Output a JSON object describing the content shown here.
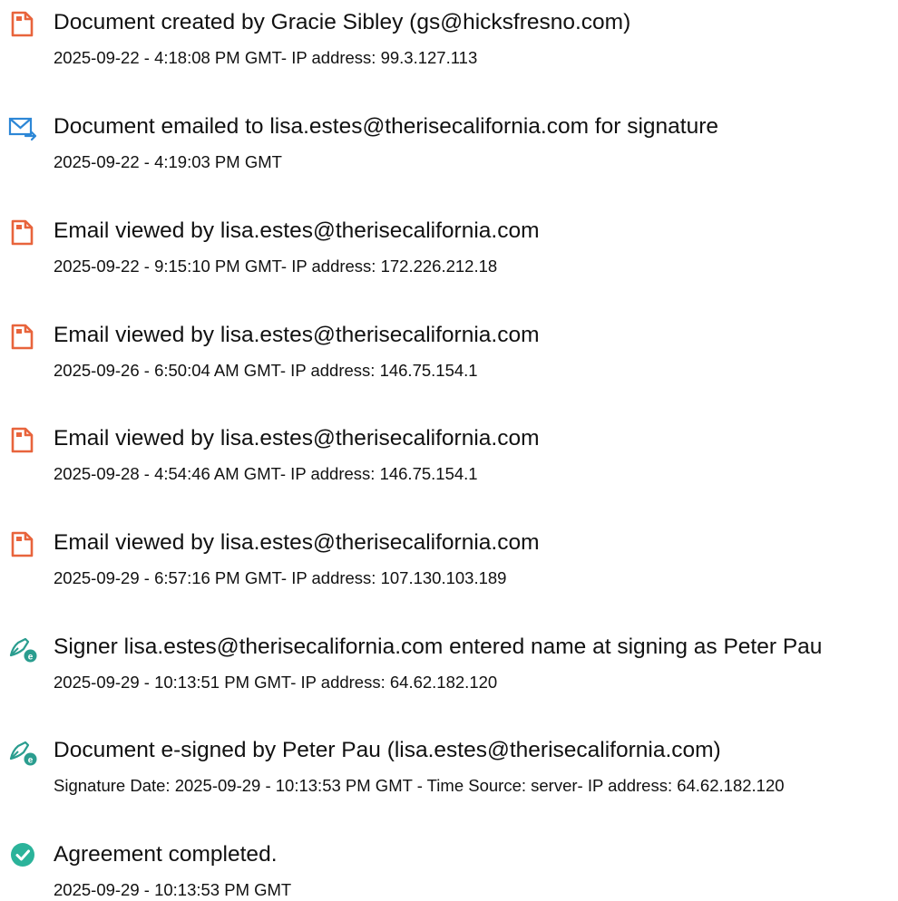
{
  "events": [
    {
      "icon": "document-icon",
      "title": "Document created by Gracie Sibley (gs@hicksfresno.com)",
      "detail": "2025-09-22 - 4:18:08 PM GMT- IP address: 99.3.127.113"
    },
    {
      "icon": "email-send-icon",
      "title": "Document emailed to lisa.estes@therisecalifornia.com for signature",
      "detail": "2025-09-22 - 4:19:03 PM GMT"
    },
    {
      "icon": "document-icon",
      "title": "Email viewed by lisa.estes@therisecalifornia.com",
      "detail": "2025-09-22 - 9:15:10 PM GMT- IP address: 172.226.212.18"
    },
    {
      "icon": "document-icon",
      "title": "Email viewed by lisa.estes@therisecalifornia.com",
      "detail": "2025-09-26 - 6:50:04 AM GMT- IP address: 146.75.154.1"
    },
    {
      "icon": "document-icon",
      "title": "Email viewed by lisa.estes@therisecalifornia.com",
      "detail": "2025-09-28 - 4:54:46 AM GMT- IP address: 146.75.154.1"
    },
    {
      "icon": "document-icon",
      "title": "Email viewed by lisa.estes@therisecalifornia.com",
      "detail": "2025-09-29 - 6:57:16 PM GMT- IP address: 107.130.103.189"
    },
    {
      "icon": "pen-sign-icon",
      "title": "Signer lisa.estes@therisecalifornia.com entered name at signing as Peter Pau",
      "detail": "2025-09-29 - 10:13:51 PM GMT- IP address: 64.62.182.120"
    },
    {
      "icon": "pen-sign-icon",
      "title": "Document e-signed by Peter Pau (lisa.estes@therisecalifornia.com)",
      "detail": "Signature Date: 2025-09-29 - 10:13:53 PM GMT - Time Source: server- IP address: 64.62.182.120"
    },
    {
      "icon": "check-circle-icon",
      "title": "Agreement completed.",
      "detail": "2025-09-29 - 10:13:53 PM GMT"
    }
  ],
  "colors": {
    "document_icon": "#E8643C",
    "email_icon": "#2D87D6",
    "pen_icon": "#2A9D8F",
    "check_icon": "#2BB39A",
    "text": "#111111"
  }
}
